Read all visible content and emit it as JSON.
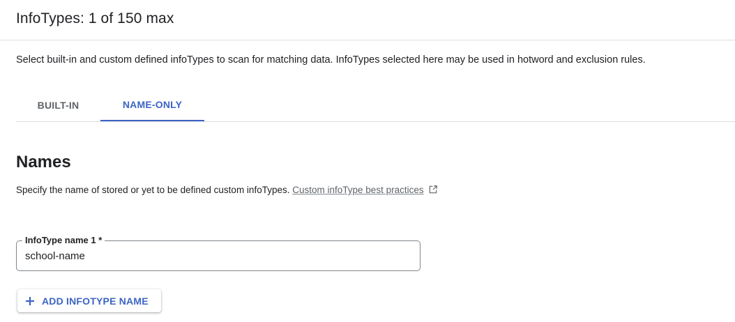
{
  "header": {
    "title": "InfoTypes: 1 of 150 max"
  },
  "description": "Select built-in and custom defined infoTypes to scan for matching data. InfoTypes selected here may be used in hotword and exclusion rules.",
  "tabs": [
    {
      "label": "BUILT-IN",
      "selected": false
    },
    {
      "label": "NAME-ONLY",
      "selected": true
    }
  ],
  "names_section": {
    "title": "Names",
    "description": "Specify the name of stored or yet to be defined custom infoTypes.",
    "link_text": "Custom infoType best practices",
    "link_icon": "open-in-new-icon"
  },
  "infotype_field": {
    "label": "InfoType name 1 *",
    "value": "school-name"
  },
  "add_button": {
    "icon": "plus-icon",
    "label": "ADD INFOTYPE NAME"
  },
  "colors": {
    "accent": "#3c64c4",
    "text": "#202124",
    "muted": "#5f6368",
    "divider": "#dadce0"
  }
}
